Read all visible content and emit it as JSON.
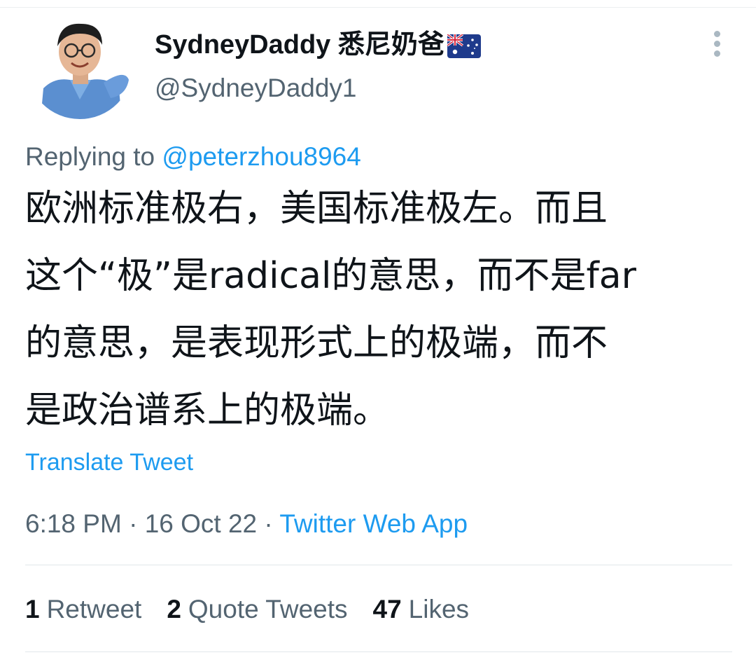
{
  "author": {
    "display_name": "SydneyDaddy 悉尼奶爸",
    "flag_icon": "australia-flag-icon",
    "handle": "@SydneyDaddy1"
  },
  "menu_icon": "more-options-icon",
  "reply": {
    "prefix": "Replying to",
    "target": "@peterzhou8964"
  },
  "tweet": {
    "text": "欧洲标准极右，美国标准极左。而且\n这个“极”是radical的意思，而不是far\n的意思，是表现形式上的极端，而不\n是政治谱系上的极端。"
  },
  "translate_label": "Translate Tweet",
  "meta": {
    "time": "6:18 PM",
    "date": "16 Oct 22",
    "separator": "·",
    "source": "Twitter Web App"
  },
  "stats": {
    "retweets": {
      "count": "1",
      "label": "Retweet"
    },
    "quotes": {
      "count": "2",
      "label": "Quote Tweets"
    },
    "likes": {
      "count": "47",
      "label": "Likes"
    }
  },
  "colors": {
    "link": "#1d9bf0",
    "secondary_text": "#536471",
    "primary_text": "#0f1419"
  }
}
